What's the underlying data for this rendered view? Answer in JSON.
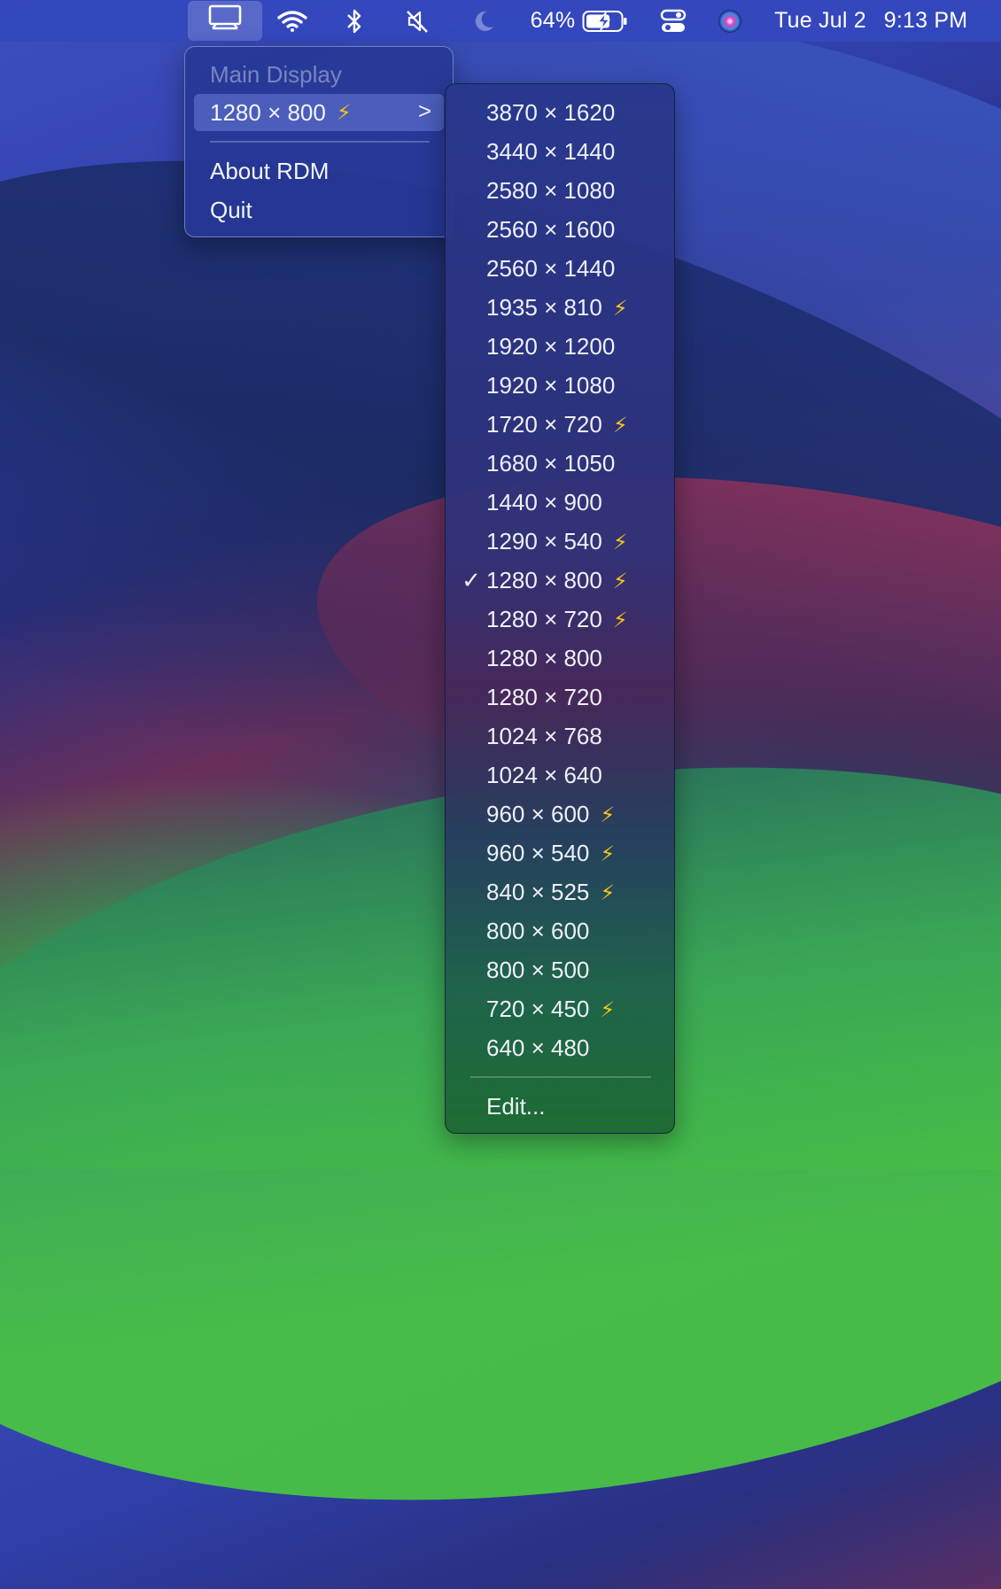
{
  "menubar": {
    "icons": [
      {
        "name": "display-icon"
      },
      {
        "name": "wifi-icon"
      },
      {
        "name": "bluetooth-icon"
      },
      {
        "name": "mute-icon"
      },
      {
        "name": "moon-icon"
      }
    ],
    "battery_percent": "64%",
    "date": "Tue Jul 2",
    "time": "9:13 PM"
  },
  "main_menu": {
    "header": "Main Display",
    "current_resolution": "1280 × 800",
    "current_bolt": "⚡",
    "chevron": ">",
    "about": "About RDM",
    "quit": "Quit"
  },
  "submenu": {
    "items": [
      {
        "label": "3870 × 1620",
        "bolt": "",
        "check": ""
      },
      {
        "label": "3440 × 1440",
        "bolt": "",
        "check": ""
      },
      {
        "label": "2580 × 1080",
        "bolt": "",
        "check": ""
      },
      {
        "label": "2560 × 1600",
        "bolt": "",
        "check": ""
      },
      {
        "label": "2560 × 1440",
        "bolt": "",
        "check": ""
      },
      {
        "label": "1935 × 810",
        "bolt": "⚡",
        "check": ""
      },
      {
        "label": "1920 × 1200",
        "bolt": "",
        "check": ""
      },
      {
        "label": "1920 × 1080",
        "bolt": "",
        "check": ""
      },
      {
        "label": "1720 × 720",
        "bolt": "⚡",
        "check": ""
      },
      {
        "label": "1680 × 1050",
        "bolt": "",
        "check": ""
      },
      {
        "label": "1440 × 900",
        "bolt": "",
        "check": ""
      },
      {
        "label": "1290 × 540",
        "bolt": "⚡",
        "check": ""
      },
      {
        "label": "1280 × 800",
        "bolt": "⚡",
        "check": "✓"
      },
      {
        "label": "1280 × 720",
        "bolt": "⚡",
        "check": ""
      },
      {
        "label": "1280 × 800",
        "bolt": "",
        "check": ""
      },
      {
        "label": "1280 × 720",
        "bolt": "",
        "check": ""
      },
      {
        "label": "1024 × 768",
        "bolt": "",
        "check": ""
      },
      {
        "label": "1024 × 640",
        "bolt": "",
        "check": ""
      },
      {
        "label": "960 × 600",
        "bolt": "⚡",
        "check": ""
      },
      {
        "label": "960 × 540",
        "bolt": "⚡",
        "check": ""
      },
      {
        "label": "840 × 525",
        "bolt": "⚡",
        "check": ""
      },
      {
        "label": "800 × 600",
        "bolt": "",
        "check": ""
      },
      {
        "label": "800 × 500",
        "bolt": "",
        "check": ""
      },
      {
        "label": "720 × 450",
        "bolt": "⚡",
        "check": ""
      },
      {
        "label": "640 × 480",
        "bolt": "",
        "check": ""
      }
    ],
    "edit": "Edit..."
  }
}
